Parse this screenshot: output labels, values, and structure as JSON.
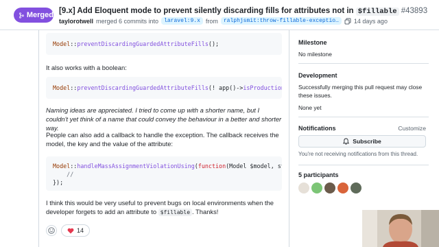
{
  "header": {
    "status_label": "Merged",
    "status_color": "#8250df",
    "title_text": "[9.x] Add Eloquent mode to prevent silently discarding fills for attributes not in",
    "title_code": "$fillable",
    "pr_number": "#43893",
    "author": "taylorotwell",
    "merge_text": "merged 6 commits into",
    "base_branch": "laravel:9.x",
    "from_text": "from",
    "head_branch": "ralphjsmit:throw-fillable-exceptio…",
    "time_ago": "14 days ago"
  },
  "comment": {
    "code1": {
      "class": "Model",
      "sep": "::",
      "func": "preventDiscardingGuardedAttributeFills",
      "rest": "();"
    },
    "para1": "It also works with a boolean:",
    "code2": {
      "class": "Model",
      "sep": "::",
      "func": "preventDiscardingGuardedAttributeFills",
      "arg_open": "(! app()->",
      "arg_func": "isProduction",
      "rest": "());"
    },
    "para2": "Naming ideas are appreciated. I tried to come up with a shorter name, but I couldn't yet think of a name that could convey the behaviour in a better and shorter way.",
    "para3": "People can also add a callback to handle the exception. The callback receives the model, the key and the value of the attribute:",
    "code3": {
      "class": "Model",
      "sep": "::",
      "func": "handleMassAssignmentViolationUsing",
      "open": "(",
      "kw": "function",
      "params": "(Model $model, string $ke",
      "comment": "    //",
      "close": "});"
    },
    "para4_before": "I think this would be very useful to prevent bugs on local environments when the developer forgets to add an attribute to",
    "para4_code": "$fillable",
    "para4_after": ". Thanks!",
    "reaction_count": "14"
  },
  "sidebar": {
    "milestone_head": "Milestone",
    "milestone_value": "No milestone",
    "development_head": "Development",
    "development_text": "Successfully merging this pull request may close these issues.",
    "development_value": "None yet",
    "notifications_head": "Notifications",
    "customize_label": "Customize",
    "subscribe_label": "Subscribe",
    "notifications_text": "You're not receiving notifications from this thread.",
    "participants_head": "5 participants",
    "avatar_colors": [
      "#e6e0d8",
      "#7cc576",
      "#6b5b4b",
      "#d9643a",
      "#5f6b5a"
    ]
  }
}
